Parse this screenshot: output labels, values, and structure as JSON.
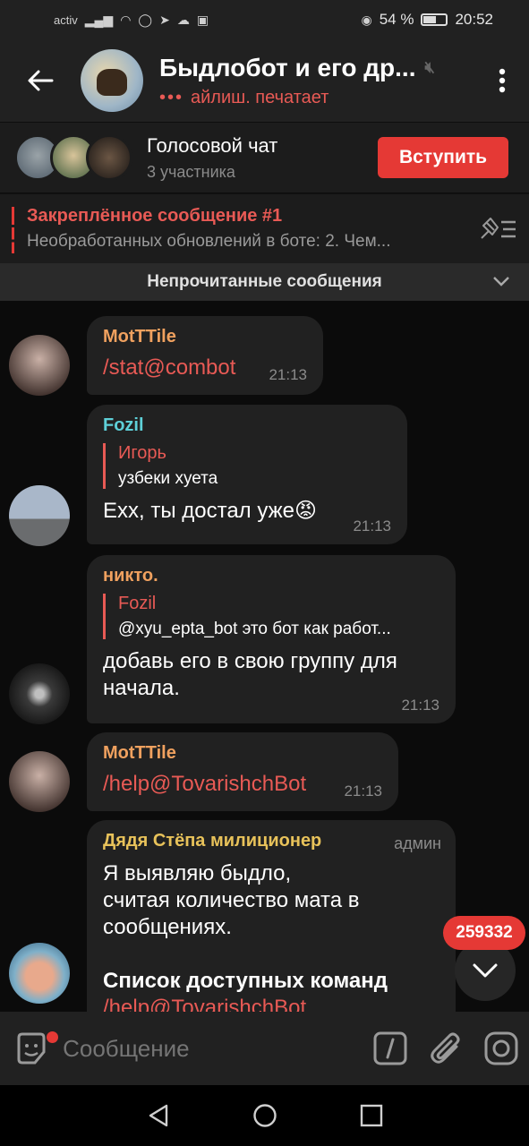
{
  "status_bar": {
    "carrier": "activ",
    "battery": "54 %",
    "time": "20:52"
  },
  "header": {
    "title": "Быдлобот и его др...",
    "typing_dots": "•••",
    "subtitle": "айлиш. печатает"
  },
  "voice_chat": {
    "title": "Голосовой чат",
    "participants": "3 участника",
    "join_label": "Вступить"
  },
  "pinned": {
    "title": "Закреплённое сообщение #1",
    "text": "Необработанных обновлений в боте: 2. Чем..."
  },
  "unread_banner": "Непрочитанные сообщения",
  "messages": [
    {
      "sender": "MotTTile",
      "sender_color": "#f0a15f",
      "text": "/stat@combot",
      "time": "21:13"
    },
    {
      "sender": "Fozil",
      "sender_color": "#5ed0d8",
      "reply_name": "Игорь",
      "reply_text": "узбеки хуета",
      "text": "Exx, ты достал уже😡",
      "time": "21:13"
    },
    {
      "sender": "никто.",
      "sender_color": "#f0a15f",
      "reply_name": "Fozil",
      "reply_text": "@xyu_epta_bot это бот как работ...",
      "text_line1": "добавь его в свою группу для",
      "text_line2": "начала.",
      "time": "21:13"
    },
    {
      "sender": "MotTTile",
      "sender_color": "#f0a15f",
      "text": "/help@TovarishchBot",
      "time": "21:13"
    },
    {
      "sender": "Дядя Стёпа милиционер",
      "sender_color": "#e8c25a",
      "badge": "админ",
      "text_line1": "Я выявляю быдло,",
      "text_line2": "считая количество мата в",
      "text_line3": "сообщениях.",
      "text_line4": "Список доступных команд",
      "text_line5": "/help@TovarishchBot"
    }
  ],
  "unread_counter": "259332",
  "composer": {
    "placeholder": "Сообщение"
  }
}
